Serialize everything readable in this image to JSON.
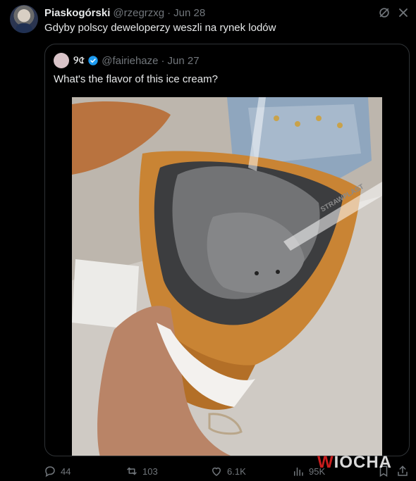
{
  "author": {
    "name": "Piaskogórski",
    "handle": "@rzegrzxg",
    "separator": "·",
    "date": "Jun 28"
  },
  "tweet": {
    "text": "Gdyby polscy deweloperzy weszli na rynek lodów"
  },
  "quoted": {
    "name": "୨৫",
    "handle": "@fairiehaze",
    "separator": "·",
    "date": "Jun 27",
    "text": "What's the flavor of this ice cream?",
    "verified": true,
    "image_text": "STRAWPLAST"
  },
  "actions": {
    "replies": "44",
    "reposts": "103",
    "likes": "6.1K",
    "views": "95K"
  },
  "watermark": {
    "w": "W",
    "rest": "IOCHA"
  },
  "colors": {
    "background": "#000000",
    "text": "#e7e9ea",
    "secondary": "#71767b",
    "border": "#2f3336",
    "verified": "#1d9bf0",
    "watermark_accent": "#c81d1d"
  }
}
